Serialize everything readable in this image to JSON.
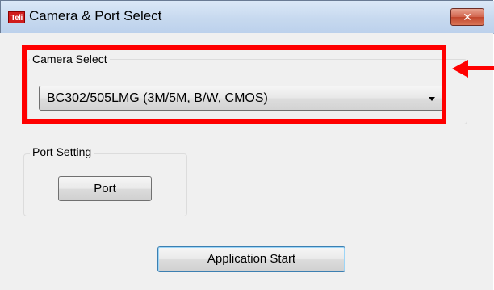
{
  "window": {
    "title": "Camera & Port Select",
    "app_icon_text": "Teli",
    "close_symbol": "✕"
  },
  "camera_select": {
    "group_label": "Camera Select",
    "selected_value": "BC302/505LMG (3M/5M, B/W, CMOS)"
  },
  "port_setting": {
    "group_label": "Port Setting",
    "port_button_label": "Port"
  },
  "actions": {
    "start_button_label": "Application Start"
  },
  "annotation": {
    "highlight_color": "#ff0000"
  }
}
